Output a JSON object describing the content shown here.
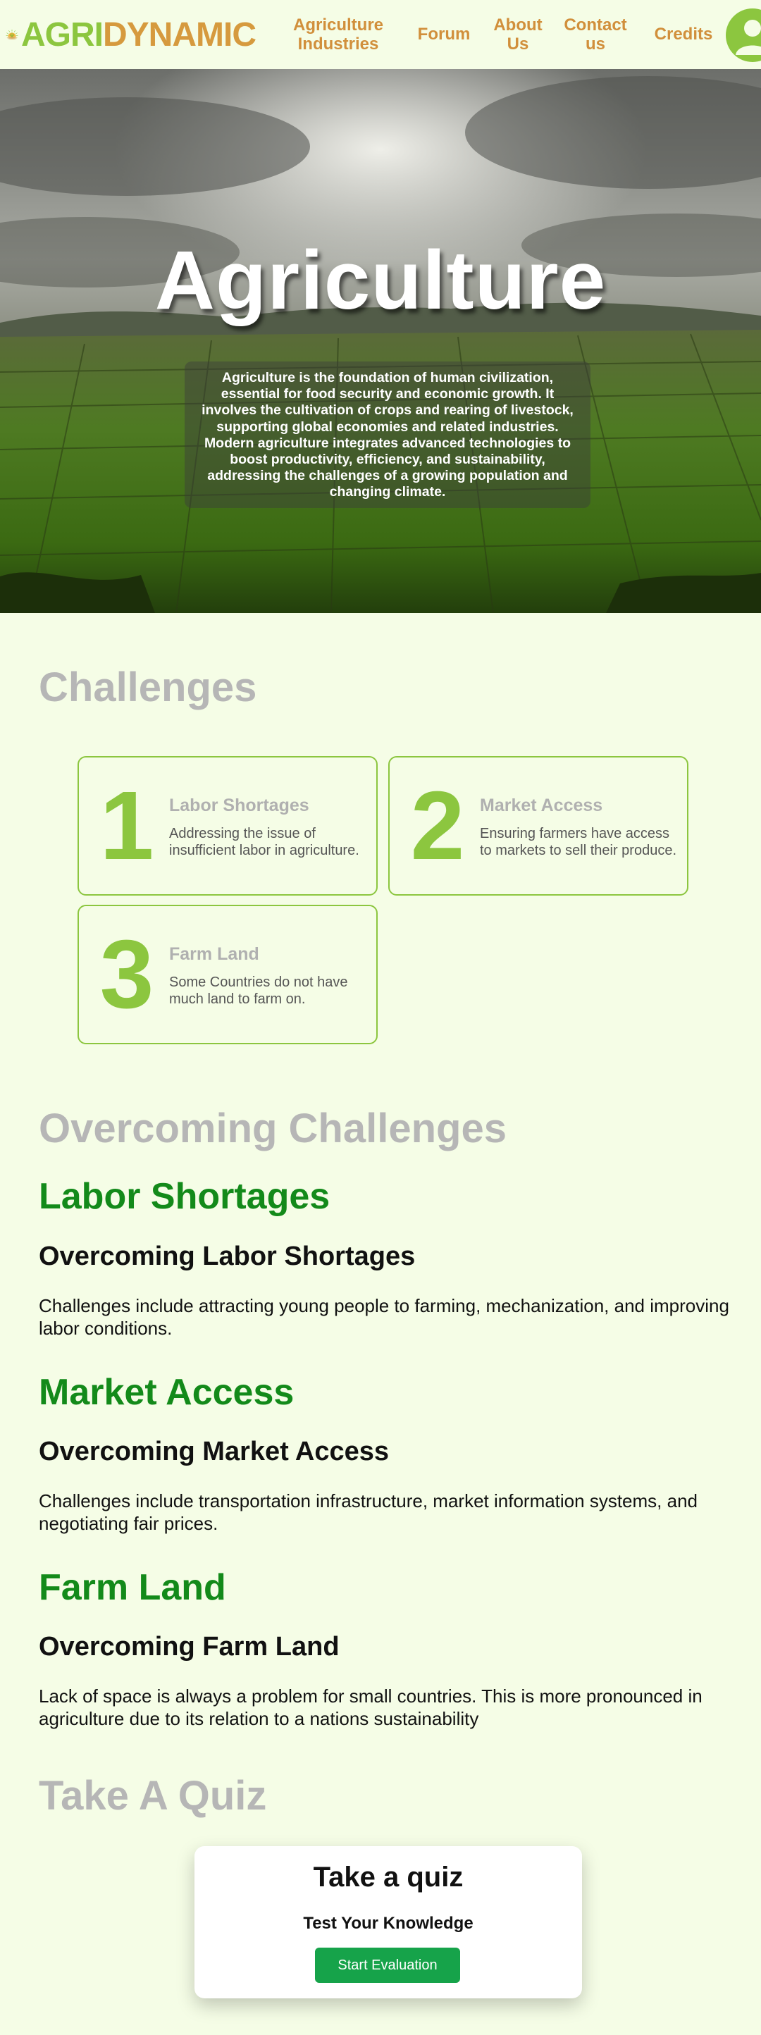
{
  "brand": {
    "part1": "AGRI",
    "part2": "DYNAMIC"
  },
  "nav": {
    "links": [
      {
        "label_line1": "Agriculture",
        "label_line2": "Industries"
      },
      {
        "label": "Forum"
      },
      {
        "label_line1": "About",
        "label_line2": "Us"
      },
      {
        "label_line1": "Contact",
        "label_line2": "us"
      },
      {
        "label": "Credits"
      }
    ],
    "avatar_icon": "user-icon"
  },
  "hero": {
    "title": "Agriculture",
    "description": "Agriculture is the foundation of human civilization, essential for food security and economic growth. It involves the cultivation of crops and rearing of livestock, supporting global economies and related industries. Modern agriculture integrates advanced technologies to boost productivity, efficiency, and sustainability, addressing the challenges of a growing population and changing climate."
  },
  "challenges": {
    "title": "Challenges",
    "items": [
      {
        "number": "1",
        "title": "Labor Shortages",
        "desc": "Addressing the issue of insufficient labor in agriculture."
      },
      {
        "number": "2",
        "title": "Market Access",
        "desc": "Ensuring farmers have access to markets to sell their produce."
      },
      {
        "number": "3",
        "title": "Farm Land",
        "desc": "Some Countries do not have much land to farm on."
      }
    ]
  },
  "overcoming": {
    "title": "Overcoming Challenges",
    "items": [
      {
        "heading": "Labor Shortages",
        "subheading": "Overcoming Labor Shortages",
        "text": "Challenges include attracting young people to farming, mechanization, and improving labor conditions."
      },
      {
        "heading": "Market Access",
        "subheading": "Overcoming Market Access",
        "text": "Challenges include transportation infrastructure, market information systems, and negotiating fair prices."
      },
      {
        "heading": "Farm Land",
        "subheading": "Overcoming Farm Land",
        "text": "Lack of space is always a problem for small countries. This is more pronounced in agriculture due to its relation to a nations sustainability"
      }
    ]
  },
  "quiz": {
    "section_title": "Take A Quiz",
    "card_title": "Take a quiz",
    "subtitle": "Test Your Knowledge",
    "button": "Start Evaluation"
  },
  "colors": {
    "background": "#f5fde6",
    "brand_green": "#8cc63f",
    "brand_orange": "#d69a3e",
    "heading_green": "#138a1a",
    "button_green": "#16a34a",
    "muted_gray": "#b6b6b6"
  }
}
